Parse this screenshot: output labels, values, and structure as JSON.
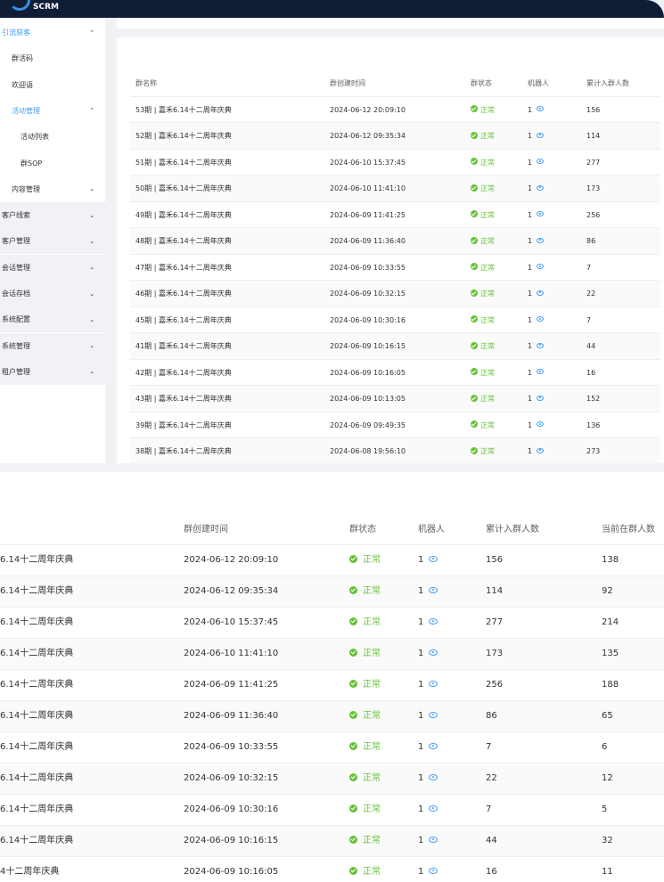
{
  "app": {
    "name": "SCRM"
  },
  "sidebar": {
    "items": [
      {
        "label": "引流获客",
        "arrow": "⌃",
        "state": "active-parent"
      },
      {
        "label": "群活码",
        "arrow": "",
        "state": "sub"
      },
      {
        "label": "欢迎语",
        "arrow": "",
        "state": "sub"
      },
      {
        "label": "活动管理",
        "arrow": "⌃",
        "state": "active-sub"
      },
      {
        "label": "活动列表",
        "arrow": "",
        "state": "subsub"
      },
      {
        "label": "群SOP",
        "arrow": "",
        "state": "subsub"
      },
      {
        "label": "内容管理",
        "arrow": "⌄",
        "state": "sub"
      },
      {
        "label": "客户线索",
        "arrow": "⌄",
        "state": "top"
      },
      {
        "label": "客户管理",
        "arrow": "⌄",
        "state": "top"
      },
      {
        "label": "会话管理",
        "arrow": "⌄",
        "state": "top"
      },
      {
        "label": "会话存档",
        "arrow": "⌄",
        "state": "top"
      },
      {
        "label": "系统配置",
        "arrow": "⌄",
        "state": "top"
      },
      {
        "label": "系统管理",
        "arrow": "⌄",
        "state": "top"
      },
      {
        "label": "租户管理",
        "arrow": "⌄",
        "state": "top"
      }
    ]
  },
  "table_small": {
    "headers": [
      "群名称",
      "群创建时间",
      "群状态",
      "机器人",
      "累计入群人数"
    ],
    "rows": [
      {
        "name": "53期 | 嘉禾6.14十二周年庆典",
        "created": "2024-06-12 20:09:10",
        "status": "正常",
        "robot": "1",
        "total": "156"
      },
      {
        "name": "52期 | 嘉禾6.14十二周年庆典",
        "created": "2024-06-12 09:35:34",
        "status": "正常",
        "robot": "1",
        "total": "114"
      },
      {
        "name": "51期 | 嘉禾6.14十二周年庆典",
        "created": "2024-06-10 15:37:45",
        "status": "正常",
        "robot": "1",
        "total": "277"
      },
      {
        "name": "50期 | 嘉禾6.14十二周年庆典",
        "created": "2024-06-10 11:41:10",
        "status": "正常",
        "robot": "1",
        "total": "173"
      },
      {
        "name": "49期 | 嘉禾6.14十二周年庆典",
        "created": "2024-06-09 11:41:25",
        "status": "正常",
        "robot": "1",
        "total": "256"
      },
      {
        "name": "48期 | 嘉禾6.14十二周年庆典",
        "created": "2024-06-09 11:36:40",
        "status": "正常",
        "robot": "1",
        "total": "86"
      },
      {
        "name": "47期 | 嘉禾6.14十二周年庆典",
        "created": "2024-06-09 10:33:55",
        "status": "正常",
        "robot": "1",
        "total": "7"
      },
      {
        "name": "46期 | 嘉禾6.14十二周年庆典",
        "created": "2024-06-09 10:32:15",
        "status": "正常",
        "robot": "1",
        "total": "22"
      },
      {
        "name": "45期 | 嘉禾6.14十二周年庆典",
        "created": "2024-06-09 10:30:16",
        "status": "正常",
        "robot": "1",
        "total": "7"
      },
      {
        "name": "41期 | 嘉禾6.14十二周年庆典",
        "created": "2024-06-09 10:16:15",
        "status": "正常",
        "robot": "1",
        "total": "44"
      },
      {
        "name": "42期 | 嘉禾6.14十二周年庆典",
        "created": "2024-06-09 10:16:05",
        "status": "正常",
        "robot": "1",
        "total": "16"
      },
      {
        "name": "43期 | 嘉禾6.14十二周年庆典",
        "created": "2024-06-09 10:13:05",
        "status": "正常",
        "robot": "1",
        "total": "152"
      },
      {
        "name": "39期 | 嘉禾6.14十二周年庆典",
        "created": "2024-06-09 09:49:35",
        "status": "正常",
        "robot": "1",
        "total": "136"
      },
      {
        "name": "38期 | 嘉禾6.14十二周年庆典",
        "created": "2024-06-08 19:56:10",
        "status": "正常",
        "robot": "1",
        "total": "273"
      }
    ]
  },
  "table_zoom": {
    "headers": [
      "",
      "群创建时间",
      "群状态",
      "机器人",
      "累计入群人数",
      "当前在群人数"
    ],
    "rows": [
      {
        "name": "6.14十二周年庆典",
        "created": "2024-06-12 20:09:10",
        "status": "正常",
        "robot": "1",
        "total": "156",
        "current": "138"
      },
      {
        "name": "6.14十二周年庆典",
        "created": "2024-06-12 09:35:34",
        "status": "正常",
        "robot": "1",
        "total": "114",
        "current": "92"
      },
      {
        "name": "6.14十二周年庆典",
        "created": "2024-06-10 15:37:45",
        "status": "正常",
        "robot": "1",
        "total": "277",
        "current": "214"
      },
      {
        "name": "6.14十二周年庆典",
        "created": "2024-06-10 11:41:10",
        "status": "正常",
        "robot": "1",
        "total": "173",
        "current": "135"
      },
      {
        "name": "6.14十二周年庆典",
        "created": "2024-06-09 11:41:25",
        "status": "正常",
        "robot": "1",
        "total": "256",
        "current": "188"
      },
      {
        "name": "6.14十二周年庆典",
        "created": "2024-06-09 11:36:40",
        "status": "正常",
        "robot": "1",
        "total": "86",
        "current": "65"
      },
      {
        "name": "6.14十二周年庆典",
        "created": "2024-06-09 10:33:55",
        "status": "正常",
        "robot": "1",
        "total": "7",
        "current": "6"
      },
      {
        "name": "6.14十二周年庆典",
        "created": "2024-06-09 10:32:15",
        "status": "正常",
        "robot": "1",
        "total": "22",
        "current": "12"
      },
      {
        "name": "6.14十二周年庆典",
        "created": "2024-06-09 10:30:16",
        "status": "正常",
        "robot": "1",
        "total": "7",
        "current": "5"
      },
      {
        "name": "6.14十二周年庆典",
        "created": "2024-06-09 10:16:15",
        "status": "正常",
        "robot": "1",
        "total": "44",
        "current": "32"
      },
      {
        "name": "4十二周年庆典",
        "created": "2024-06-09 10:16:05",
        "status": "正常",
        "robot": "1",
        "total": "16",
        "current": "11"
      }
    ]
  }
}
